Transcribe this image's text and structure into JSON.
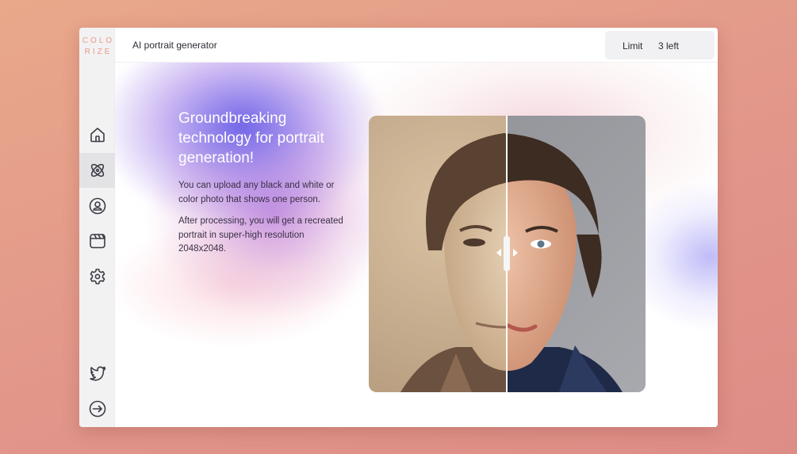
{
  "logo": {
    "line1": "COLO",
    "line2": "RIZE"
  },
  "header": {
    "title": "AI portrait generator"
  },
  "limit": {
    "label": "Limit",
    "value": "3 left"
  },
  "sidebar": {
    "items": [
      {
        "name": "home",
        "icon": "home-icon",
        "active": false
      },
      {
        "name": "generator",
        "icon": "atom-icon",
        "active": true
      },
      {
        "name": "profile",
        "icon": "user-circle-icon",
        "active": false
      },
      {
        "name": "gallery",
        "icon": "clapper-icon",
        "active": false
      },
      {
        "name": "settings",
        "icon": "gear-icon",
        "active": false
      }
    ],
    "bottom": [
      {
        "name": "twitter",
        "icon": "twitter-icon"
      },
      {
        "name": "logout",
        "icon": "logout-icon"
      }
    ]
  },
  "hero": {
    "headline": "Groundbreaking technology for portrait generation!",
    "para1": "You can upload any black and white or color photo that shows one person.",
    "para2": "After processing, you will get a recreated portrait in super-high resolution 2048x2048."
  },
  "compare": {
    "split": 0.5
  },
  "colors": {
    "accent": "#ec9b86",
    "background": "#e2968a",
    "gradient_violet": "#685ce6",
    "text_dark": "#3b3046"
  }
}
